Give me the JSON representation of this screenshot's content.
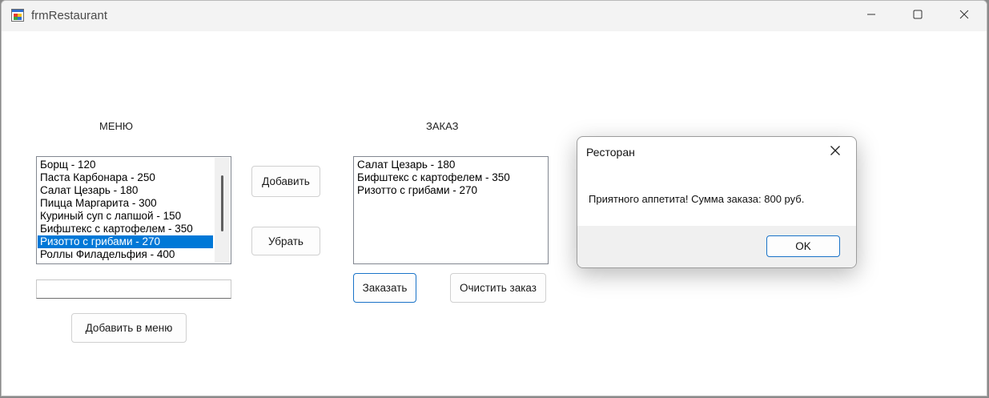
{
  "window": {
    "title": "frmRestaurant",
    "icon": "winforms-app-icon",
    "controls": [
      "minimize-icon",
      "maximize-icon",
      "close-icon"
    ]
  },
  "menu_section": {
    "label": "МЕНЮ",
    "items": [
      "Борщ - 120",
      "Паста Карбонара - 250",
      "Салат Цезарь - 180",
      "Пицца Маргарита - 300",
      "Куриный суп с лапшой - 150",
      "Бифштекс с картофелем - 350",
      "Ризотто с грибами - 270",
      "Роллы Филадельфия - 400"
    ],
    "selected_index": 6,
    "new_item_value": "",
    "add_to_menu_label": "Добавить в меню"
  },
  "actions": {
    "add_label": "Добавить",
    "remove_label": "Убрать"
  },
  "order_section": {
    "label": "ЗАКАЗ",
    "items": [
      "Салат Цезарь - 180",
      "Бифштекс с картофелем - 350",
      "Ризотто с грибами - 270"
    ],
    "order_label": "Заказать",
    "clear_label": "Очистить заказ"
  },
  "dialog": {
    "title": "Ресторан",
    "message": "Приятного аппетита! Сумма заказа: 800 руб.",
    "ok_label": "OK"
  },
  "colors": {
    "selection": "#0078d7",
    "focus_border": "#1a73c8"
  }
}
